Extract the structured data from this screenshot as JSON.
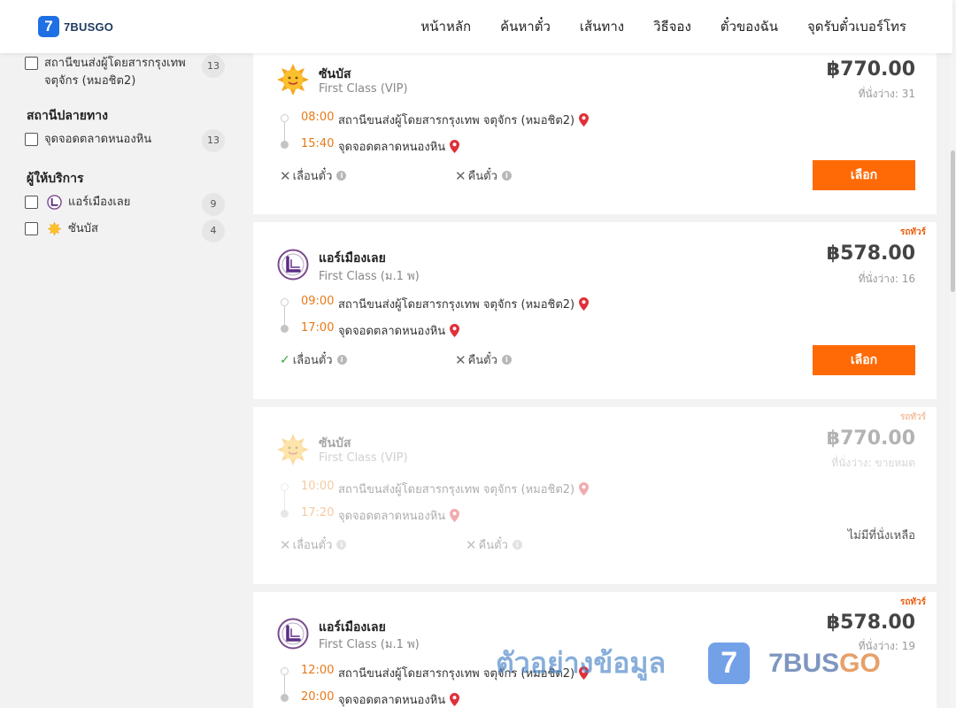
{
  "header": {
    "logo_mark": "7",
    "logo_text": "7BUSGO",
    "nav": [
      "หน้าหลัก",
      "ค้นหาตั๋ว",
      "เส้นทาง",
      "วิธีจอง",
      "ตั๋วของฉัน",
      "จุดรับตั๋วเบอร์โทร"
    ]
  },
  "sidebar": {
    "origin_station": {
      "line1": "สถานีขนส่งผู้โดยสารกรุงเทพ",
      "line2": "จตุจักร (หมอชิต2)",
      "count": "13"
    },
    "destination_title": "สถานีปลายทาง",
    "destination_station": {
      "label": "จุดจอดตลาดหนองหิน",
      "count": "13"
    },
    "provider_title": "ผู้ให้บริการ",
    "providers": [
      {
        "label": "แอร์เมืองเลย",
        "count": "9",
        "icon": "air-mueang-loei-logo"
      },
      {
        "label": "ซันบัส",
        "count": "4",
        "icon": "sunbus-sun-logo"
      }
    ]
  },
  "trips": [
    {
      "operator": "ซันบัส",
      "class": "First Class (VIP)",
      "icon": "sunbus-sun-logo",
      "price": "฿770.00",
      "seats": "ที่นั่งว่าง: 31",
      "tag": "",
      "dep_time": "08:00",
      "dep_station": "สถานีขนส่งผู้โดยสารกรุงเทพ จตุจักร (หมอชิต2)",
      "arr_time": "15:40",
      "arr_station": "จุดจอดตลาดหนองหิน",
      "change_label": "เลื่อนตั๋ว",
      "change_allowed": false,
      "refund_label": "คืนตั๋ว",
      "refund_allowed": false,
      "action": "เลือก"
    },
    {
      "operator": "แอร์เมืองเลย",
      "class": "First Class (ม.1 พ)",
      "icon": "air-mueang-loei-logo",
      "price": "฿578.00",
      "seats": "ที่นั่งว่าง: 16",
      "tag": "รถทัวร์",
      "dep_time": "09:00",
      "dep_station": "สถานีขนส่งผู้โดยสารกรุงเทพ จตุจักร (หมอชิต2)",
      "arr_time": "17:00",
      "arr_station": "จุดจอดตลาดหนองหิน",
      "change_label": "เลื่อนตั๋ว",
      "change_allowed": true,
      "refund_label": "คืนตั๋ว",
      "refund_allowed": false,
      "action": "เลือก"
    },
    {
      "operator": "ซันบัส",
      "class": "First Class (VIP)",
      "icon": "sunbus-sun-logo",
      "price": "฿770.00",
      "seats": "ที่นั่งว่าง: ขายหมด",
      "tag": "รถทัวร์",
      "dep_time": "10:00",
      "dep_station": "สถานีขนส่งผู้โดยสารกรุงเทพ จตุจักร (หมอชิต2)",
      "arr_time": "17:20",
      "arr_station": "จุดจอดตลาดหนองหิน",
      "change_label": "เลื่อนตั๋ว",
      "change_allowed": false,
      "refund_label": "คืนตั๋ว",
      "refund_allowed": false,
      "status": "ไม่มีที่นั่งเหลือ"
    },
    {
      "operator": "แอร์เมืองเลย",
      "class": "First Class (ม.1 พ)",
      "icon": "air-mueang-loei-logo",
      "price": "฿578.00",
      "seats": "ที่นั่งว่าง: 19",
      "tag": "รถทัวร์",
      "dep_time": "12:00",
      "dep_station": "สถานีขนส่งผู้โดยสารกรุงเทพ จตุจักร (หมอชิต2)",
      "arr_time": "20:00",
      "arr_station": "จุดจอดตลาดหนองหิน"
    }
  ],
  "watermark": {
    "text": "ตัวอย่างข้อมูล",
    "logo_mark": "7",
    "brand_a": "7BUS",
    "brand_b": "GO"
  },
  "colors": {
    "accent": "#ff6a06",
    "time": "#e87a17",
    "pin": "#e0303a",
    "brand_blue": "#1f6fe5"
  }
}
